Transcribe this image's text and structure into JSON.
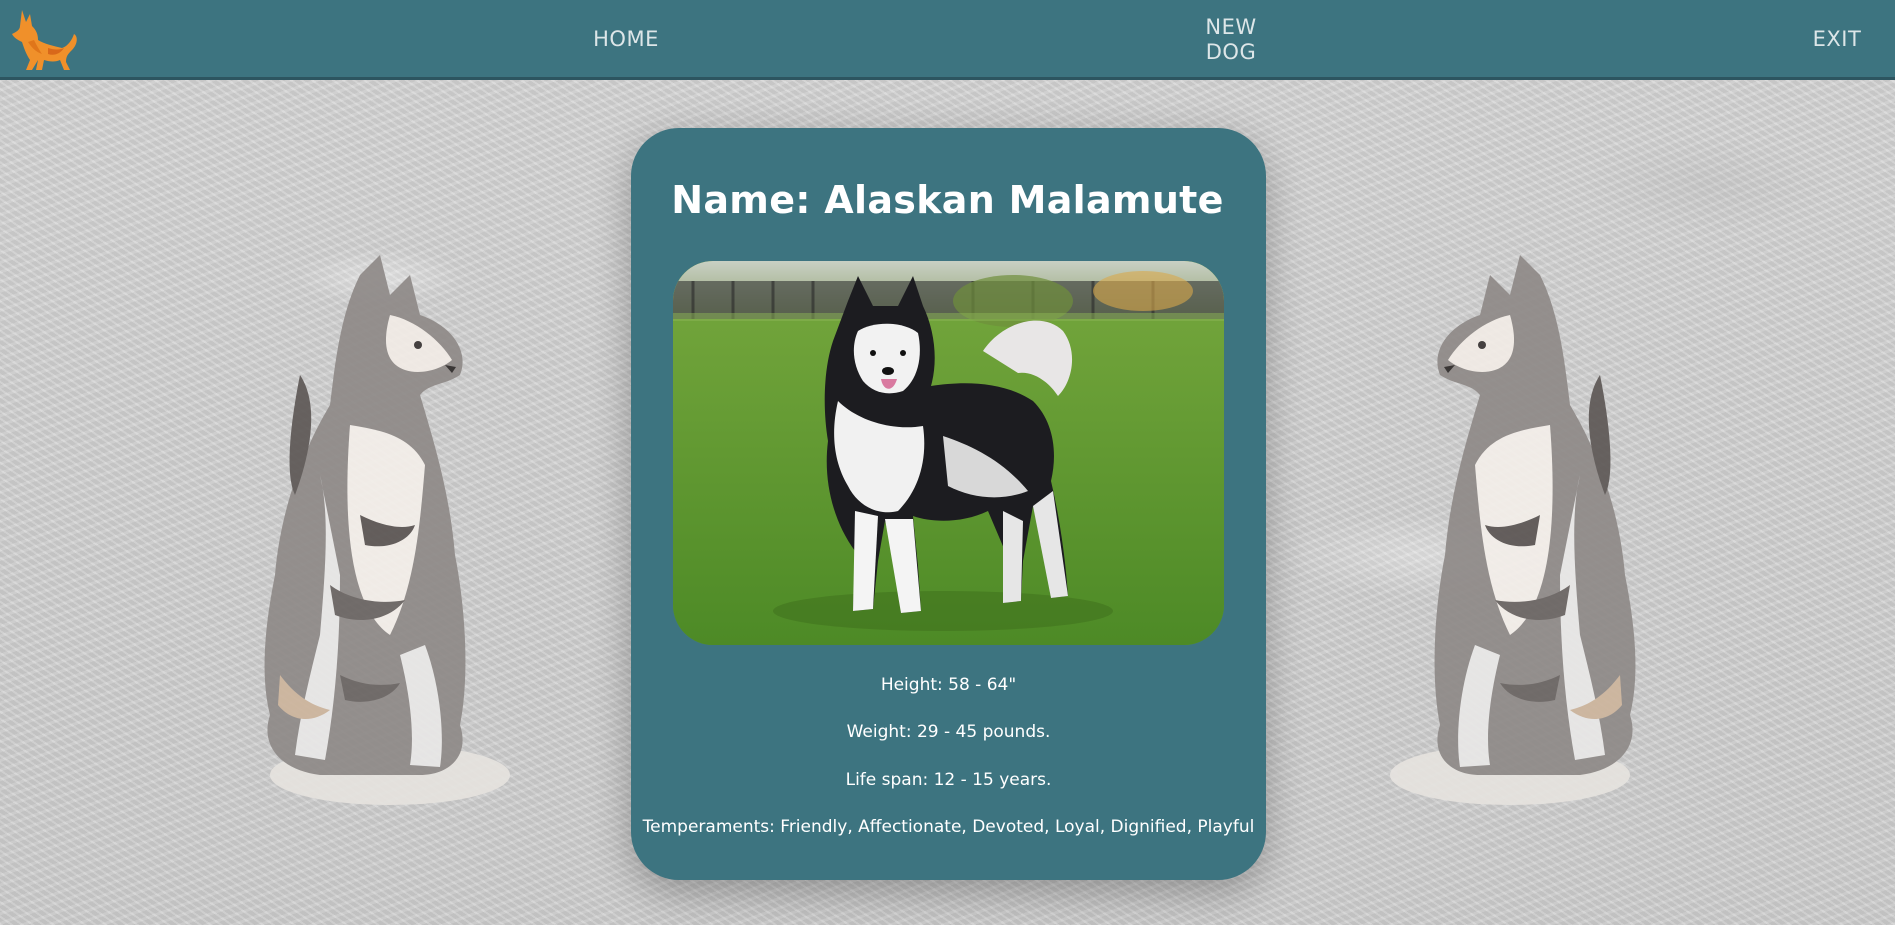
{
  "nav": {
    "logo_icon": "dog-logo-icon",
    "home_label": "HOME",
    "new_dog_line1": "NEW",
    "new_dog_line2": "DOG",
    "exit_label": "EXIT"
  },
  "dog": {
    "title": "Name: Alaskan Malamute",
    "height": "Height: 58 - 64\"",
    "weight": "Weight: 29 - 45 pounds.",
    "life_span": "Life span: 12 - 15 years.",
    "temperaments": "Temperaments: Friendly, Affectionate, Devoted, Loyal, Dignified, Playful"
  },
  "colors": {
    "navbar": "#3d7480",
    "card": "#3d7480",
    "logo": "#f0902a"
  }
}
